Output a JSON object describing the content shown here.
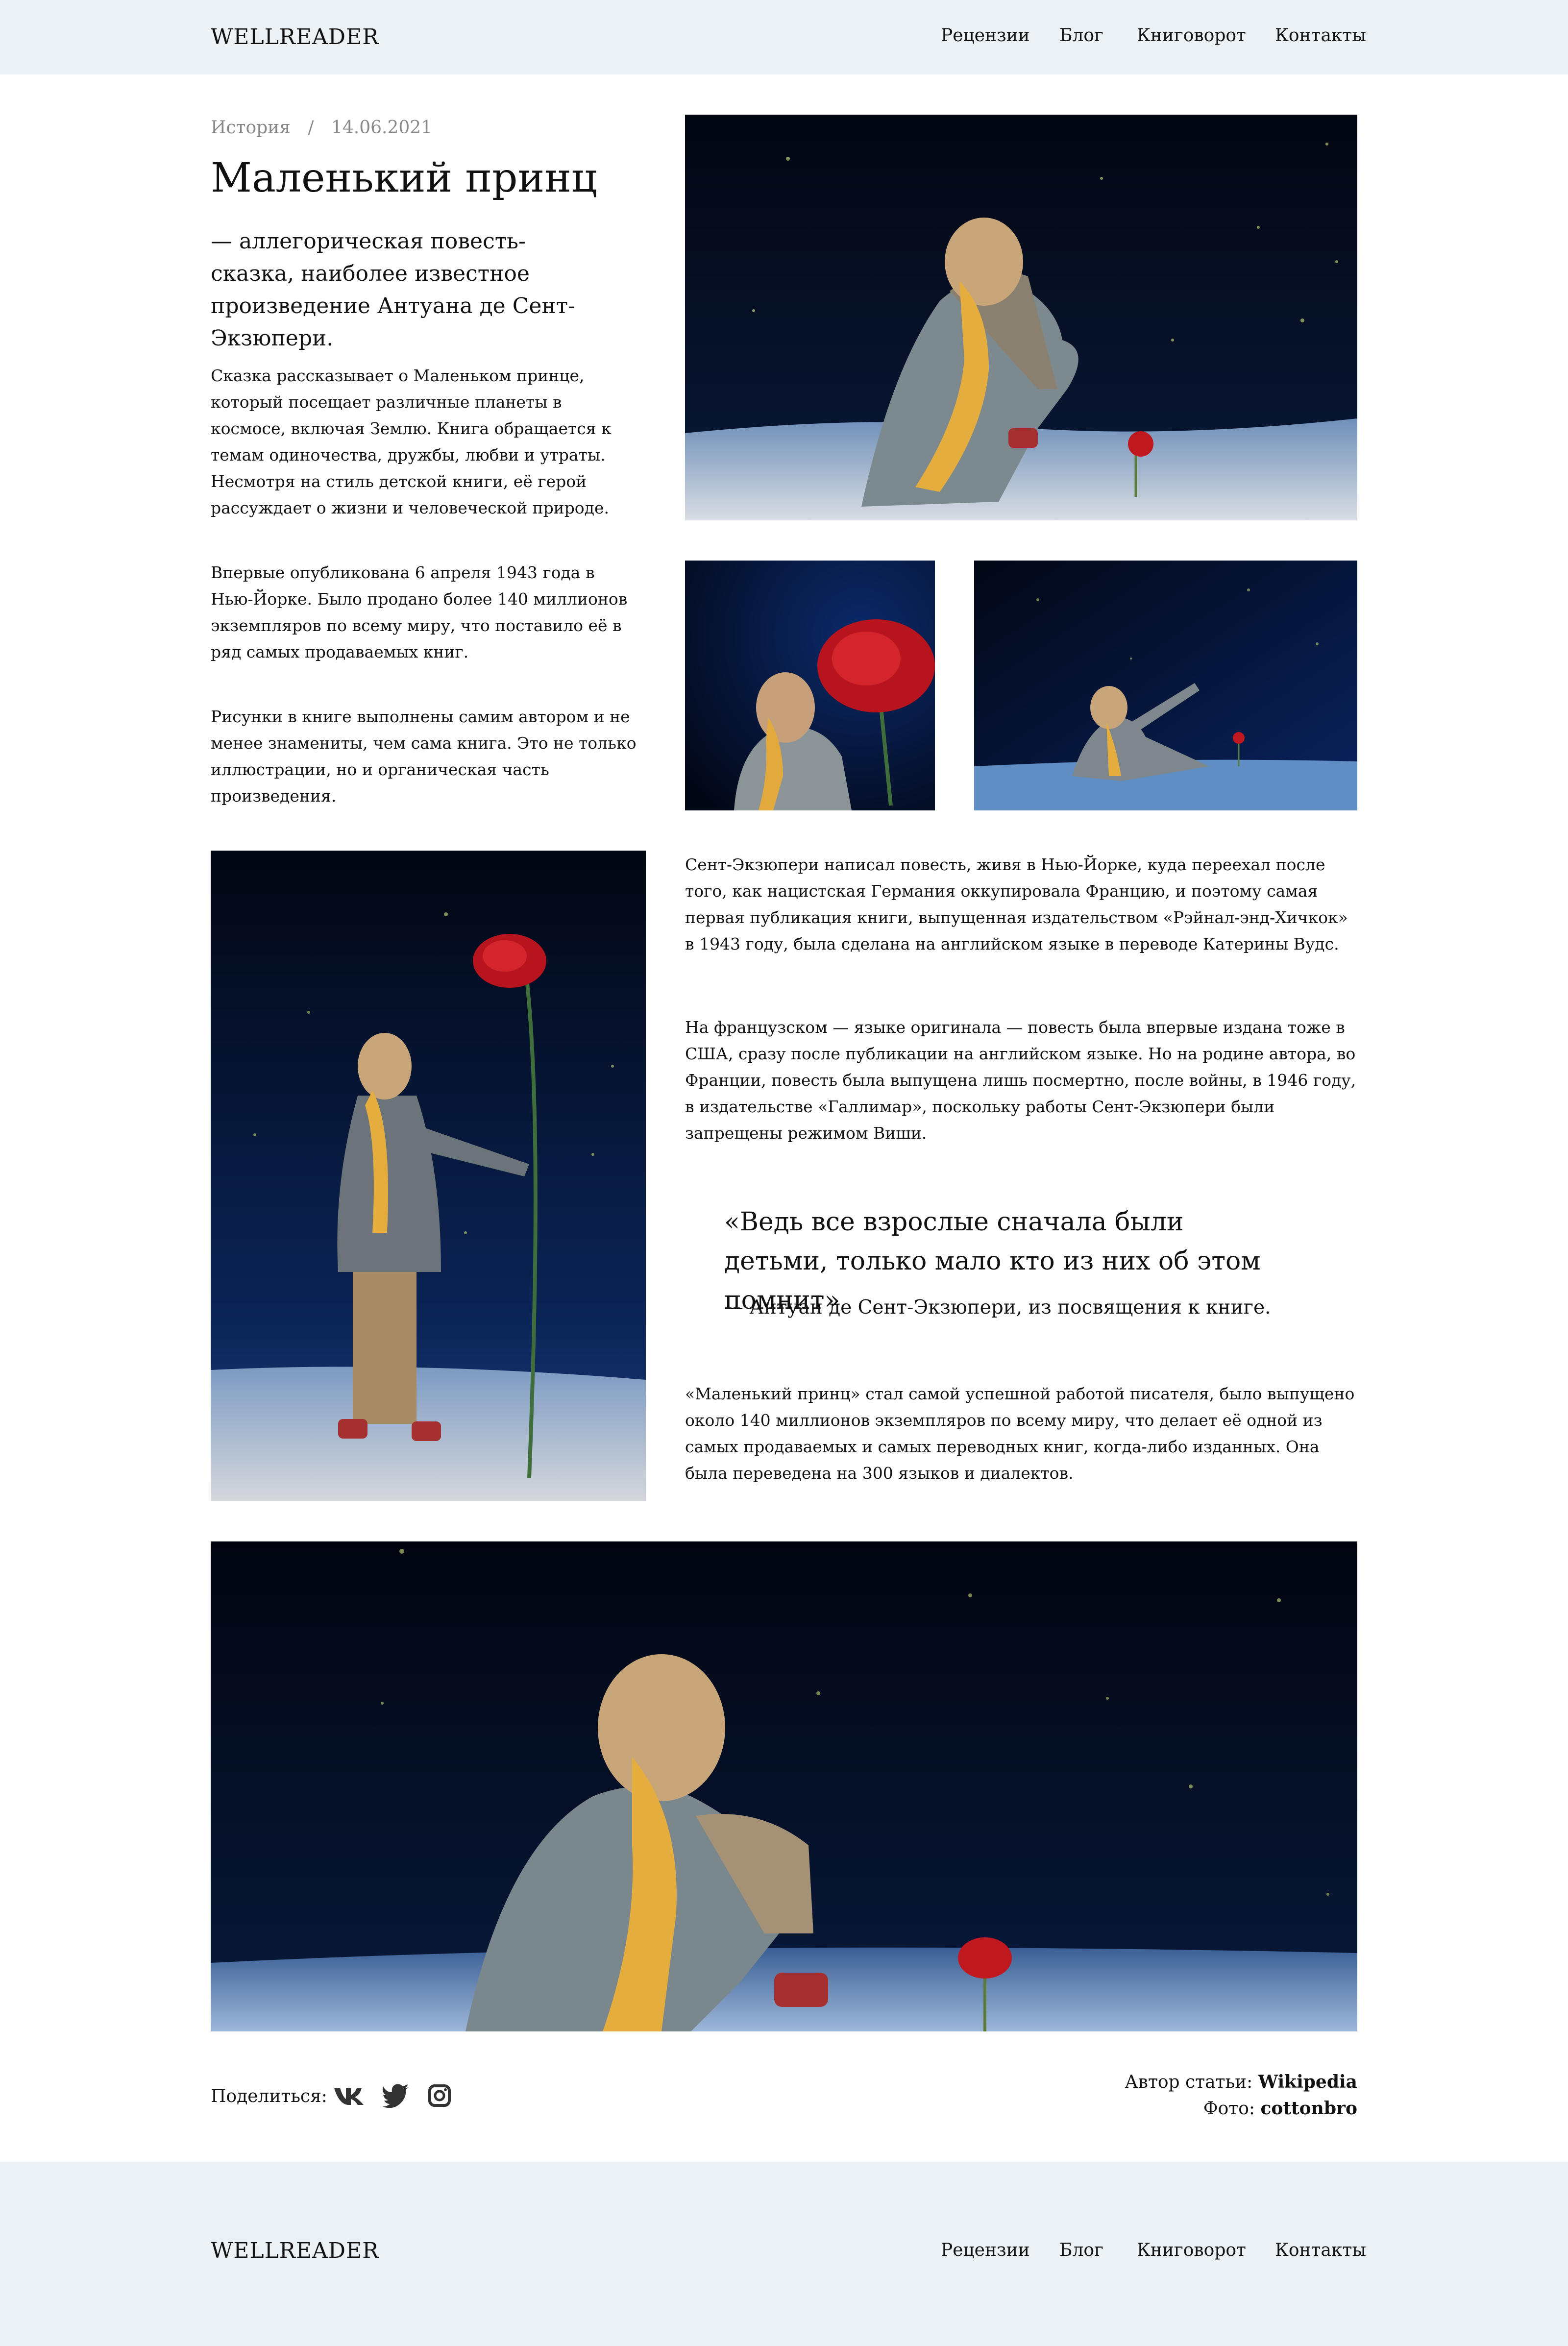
{
  "brand": "WELLREADER",
  "nav": [
    "Рецензии",
    "Блог",
    "Книговорот",
    "Контакты"
  ],
  "breadcrumb": {
    "category": "История",
    "separator": "/",
    "date": "14.06.2021"
  },
  "article": {
    "title": "Маленький принц",
    "lead": "— аллегорическая повесть-сказка, наиболее известное произведение Антуана де Сент-Экзюпери.",
    "paragraphs": [
      "Сказка рассказывает о Маленьком принце, который посещает различные планеты в космосе, включая Землю. Книга обращается к темам одиночества, дружбы, любви и утраты. Несмотря на стиль детской книги, её герой рассуждает о жизни и человеческой природе.",
      "Впервые опубликована 6 апреля 1943 года в Нью-Йорке. Было продано более 140 миллионов экземпляров по всему миру, что поставило её в ряд самых продаваемых книг.",
      "Рисунки в книге выполнены самим автором и не менее знамениты, чем сама книга. Это не только иллюстрации, но и органическая часть произведения.",
      "Сент-Экзюпери написал повесть, живя в Нью-Йорке, куда переехал после того, как нацистская Германия оккупировала Францию, и поэтому самая первая публикация книги, выпущенная издательством «Рэйнал-энд-Хичкок» в 1943 году, была сделана на английском языке в переводе Катерины Вудс.",
      "На французском — языке оригинала — повесть была впервые издана тоже в США, сразу после публикации на английском языке. Но на родине автора, во Франции, повесть была выпущена лишь посмертно, после войны, в 1946 году, в издательстве «Галлимар», поскольку работы Сент-Экзюпери были запрещены режимом Виши.",
      "«Маленький принц» стал самой успешной работой писателя, было выпущено около 140 миллионов экземпляров по всему миру, что делает её одной из самых продаваемых и самых переводных книг, когда-либо изданных. Она была переведена на 300 языков и диалектов."
    ],
    "quote": "«Ведь все взрослые сначала были детьми, только мало кто из них об этом помнит»",
    "quote_source": "— Антуан де Сент-Экзюпери, из посвящения к книге."
  },
  "share": {
    "label": "Поделиться:",
    "icons": [
      "vk-icon",
      "twitter-icon",
      "instagram-icon"
    ]
  },
  "credits": {
    "author_label": "Автор статьи:",
    "author": "Wikipedia",
    "photo_label": "Фото:",
    "photo": "cottonbro"
  },
  "colors": {
    "header_bg": "#ebf1f4",
    "night_sky": "#030714",
    "rose": "#c0181f",
    "scarf": "#e0a93a"
  }
}
